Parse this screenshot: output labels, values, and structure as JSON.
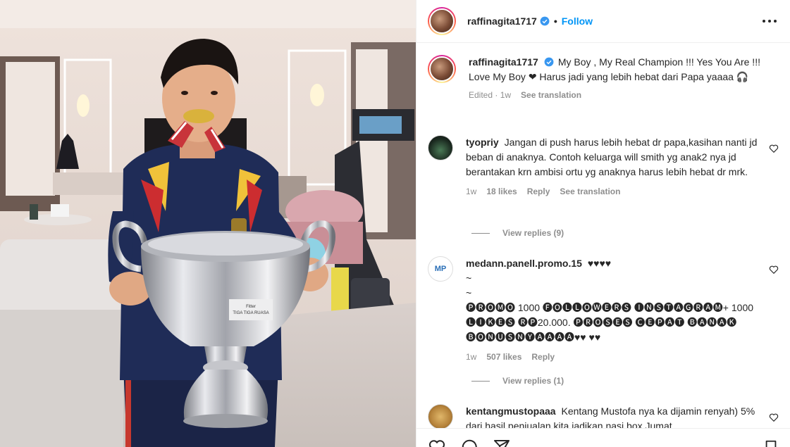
{
  "post": {
    "username": "raffinagita1717",
    "dot": "•",
    "follow_label": "Follow",
    "caption": "My Boy , My Real Champion !!! Yes You Are !!! Love My Boy ❤ Harus jadi yang lebih hebat dari Papa yaaaa 🎧",
    "edited": "Edited · 1w",
    "see_translation": "See translation",
    "photo": {
      "trophy_text_1": "Fitter",
      "trophy_text_2": "TIGA TIGA RUASA"
    }
  },
  "comments": [
    {
      "username": "tyopriy",
      "text": "Jangan di push harus lebih hebat dr papa,kasihan nanti jd beban di anaknya. Contoh keluarga will smith yg anak2 nya jd berantakan krn ambisi ortu yg anaknya harus lebih hebat dr mrk.",
      "time": "1w",
      "likes": "18 likes",
      "reply": "Reply",
      "translation": "See translation",
      "view_replies": "View replies (9)"
    },
    {
      "username": "medann.panell.promo.15",
      "text_line1": "♥♥♥♥",
      "text_line2": "~",
      "text_line3": "~",
      "text_line4": "🅟🅡🅞🅜🅞 1000 🅕🅞🅛🅛🅞🅦🅔🅡🅢 🅘🅝🅢🅣🅐🅖🅡🅐🅜+ 1000 🅛🅘🅚🅔🅢 🅡🅟20.000. 🅟🅡🅞🅢🅔🅢 🅒🅔🅟🅐🅣 🅑🅐🅝🅐🅚 🅑🅞🅝🅤🅢🅝🅨🅐🅐🅐🅐♥♥ ♥♥",
      "time": "1w",
      "likes": "507 likes",
      "reply": "Reply",
      "view_replies": "View replies (1)"
    },
    {
      "username": "kentangmustopaaa",
      "text": "Kentang Mustofa nya ka dijamin renyah) 5% dari hasil penjualan kita jadikan nasi box Jumat"
    }
  ],
  "icons": {
    "verified": "verified-badge-icon",
    "heart": "heart-outline-icon",
    "more": "more-options-icon",
    "comment": "comment-icon",
    "share": "share-icon",
    "save": "save-icon"
  },
  "colors": {
    "accent": "#0095f6",
    "muted": "#8e8e8e",
    "text": "#262626"
  }
}
